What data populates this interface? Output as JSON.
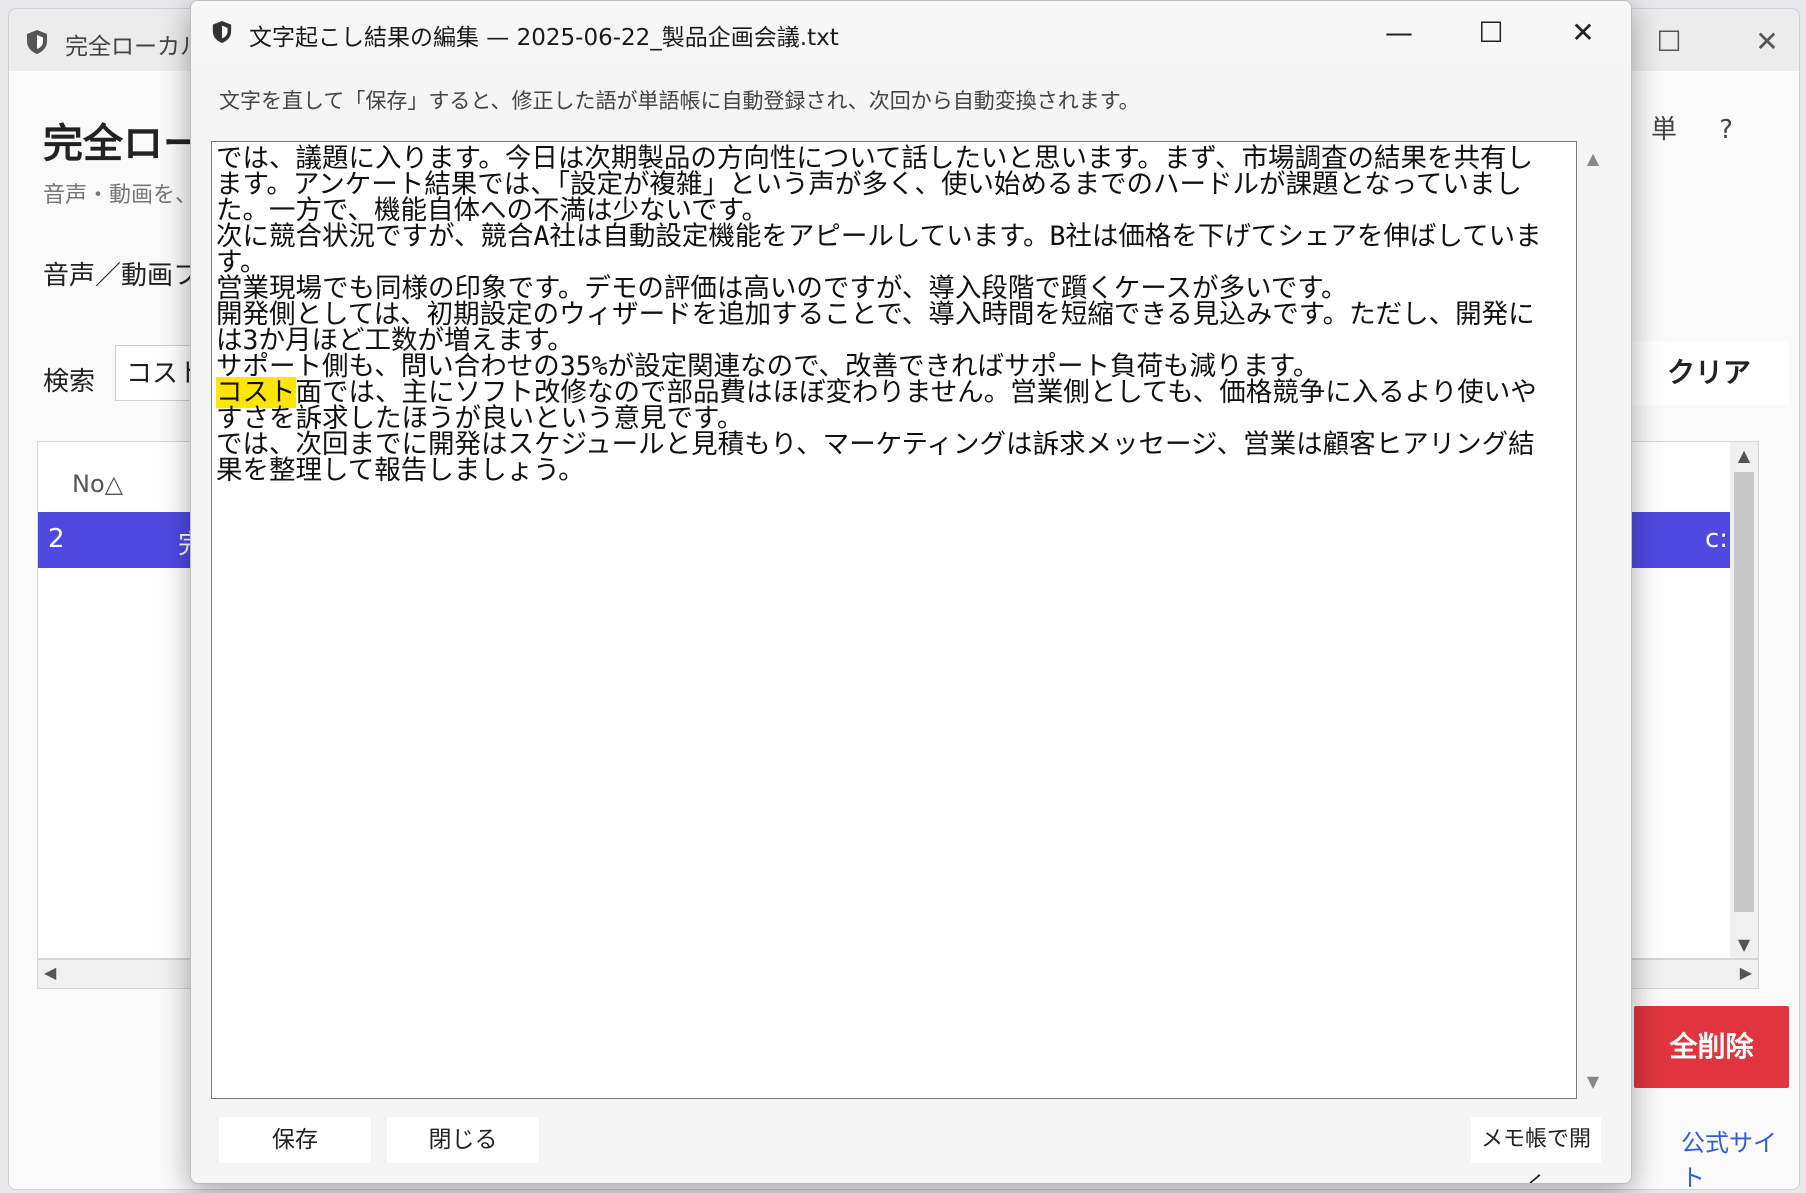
{
  "background_window": {
    "title": "完全ローカル文",
    "heading": "完全ローカ",
    "subtitle": "音声・動画を、",
    "media_label": "音声／動画フ",
    "search_label": "検索",
    "search_value": "コスト",
    "clear_label": "クリア",
    "help_icons": [
      "単",
      "?"
    ],
    "table": {
      "column_no": "No△",
      "selected_row": {
        "no": "2",
        "name": "完",
        "path": "c:"
      }
    },
    "delete_all_label": "全削除",
    "official_site_label": "公式サイト"
  },
  "dialog": {
    "title": "文字起こし結果の編集 — 2025-06-22_製品企画会議.txt",
    "hint": "文字を直して「保存」すると、修正した語が単語帳に自動登録され、次回から自動変換されます。",
    "highlight_term": "コスト",
    "lines": [
      "では、議題に入ります。今日は次期製品の方向性について話したいと思います。まず、市場調査の結果を共有します。アンケート結果では、「設定が複雑」という声が多く、使い始めるまでのハードルが課題となっていました。一方で、機能自体への不満は少ないです。",
      "次に競合状況ですが、競合A社は自動設定機能をアピールしています。B社は価格を下げてシェアを伸ばしています。",
      "営業現場でも同様の印象です。デモの評価は高いのですが、導入段階で躓くケースが多いです。",
      "開発側としては、初期設定のウィザードを追加することで、導入時間を短縮できる見込みです。ただし、開発には3か月ほど工数が増えます。",
      "サポート側も、問い合わせの35%が設定関連なので、改善できればサポート負荷も減ります。",
      "コスト面では、主にソフト改修なので部品費はほぼ変わりません。営業側としても、価格競争に入るより使いやすさを訴求したほうが良いという意見です。",
      "では、次回までに開発はスケジュールと見積もり、マーケティングは訴求メッセージ、営業は顧客ヒアリング結果を整理して報告しましょう。"
    ],
    "buttons": {
      "save": "保存",
      "close": "閉じる",
      "open_notepad": "メモ帳で開く"
    }
  }
}
